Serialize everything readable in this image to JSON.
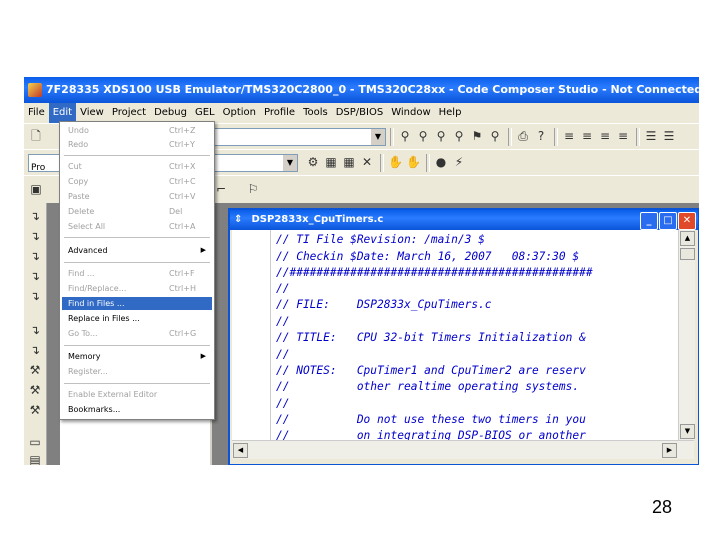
{
  "window": {
    "title": "7F28335 XDS100 USB Emulator/TMS320C2800_0 - TMS320C28xx - Code Composer Studio - Not Connected"
  },
  "menubar": [
    {
      "label": "File"
    },
    {
      "label": "Edit"
    },
    {
      "label": "View"
    },
    {
      "label": "Project"
    },
    {
      "label": "Debug"
    },
    {
      "label": "GEL"
    },
    {
      "label": "Option"
    },
    {
      "label": "Profile"
    },
    {
      "label": "Tools"
    },
    {
      "label": "DSP/BIOS"
    },
    {
      "label": "Window"
    },
    {
      "label": "Help"
    }
  ],
  "toolbar": {
    "project_combo_value": "Pro"
  },
  "edit_menu": {
    "items": [
      {
        "label": "Undo",
        "shortcut": "Ctrl+Z",
        "disabled": true
      },
      {
        "label": "Redo",
        "shortcut": "Ctrl+Y",
        "disabled": true
      },
      {
        "label": "Cut",
        "shortcut": "Ctrl+X",
        "disabled": true
      },
      {
        "label": "Copy",
        "shortcut": "Ctrl+C",
        "disabled": true
      },
      {
        "label": "Paste",
        "shortcut": "Ctrl+V",
        "disabled": true
      },
      {
        "label": "Delete",
        "shortcut": "Del",
        "disabled": true
      },
      {
        "label": "Select All",
        "shortcut": "Ctrl+A",
        "disabled": true
      },
      {
        "label": "Advanced",
        "shortcut": "",
        "submenu": true
      },
      {
        "label": "Find ...",
        "shortcut": "Ctrl+F",
        "disabled": true
      },
      {
        "label": "Find/Replace...",
        "shortcut": "Ctrl+H",
        "disabled": true
      },
      {
        "label": "Find in Files ...",
        "shortcut": "",
        "highlighted": true
      },
      {
        "label": "Replace in Files ...",
        "shortcut": ""
      },
      {
        "label": "Go To...",
        "shortcut": "Ctrl+G",
        "disabled": true
      },
      {
        "label": "Memory",
        "shortcut": "",
        "submenu": true
      },
      {
        "label": "Register...",
        "shortcut": "",
        "disabled": true
      },
      {
        "label": "Enable External Editor",
        "shortcut": "",
        "disabled": true
      },
      {
        "label": "Bookmarks...",
        "shortcut": ""
      }
    ]
  },
  "editor": {
    "title": "DSP2833x_CpuTimers.c",
    "lines": [
      "// TI File $Revision: /main/3 $",
      "// Checkin $Date: March 16, 2007   08:37:30 $",
      "//#############################################",
      "//",
      "// FILE:    DSP2833x_CpuTimers.c",
      "//",
      "// TITLE:   CPU 32-bit Timers Initialization &",
      "//",
      "// NOTES:   CpuTimer1 and CpuTimer2 are reserv",
      "//          other realtime operating systems.",
      "//",
      "//          Do not use these two timers in you",
      "//          on integrating DSP-BIOS or another"
    ]
  },
  "slide": {
    "page_number": "28"
  },
  "colors": {
    "titlebar": "#0a54d8",
    "highlight": "#316ac5",
    "code_text": "#0000cc"
  }
}
